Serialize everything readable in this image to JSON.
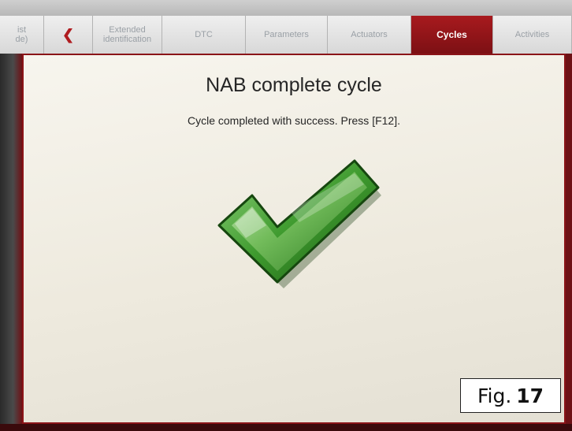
{
  "tabs": [
    {
      "label": "ist\nde)",
      "active": false
    },
    {
      "label": "",
      "active": false,
      "icon": "back-arrow-icon"
    },
    {
      "label": "Extended\nidentification",
      "active": false
    },
    {
      "label": "DTC",
      "active": false
    },
    {
      "label": "Parameters",
      "active": false
    },
    {
      "label": "Actuators",
      "active": false
    },
    {
      "label": "Cycles",
      "active": true
    },
    {
      "label": "Activities",
      "active": false
    }
  ],
  "panel": {
    "title": "NAB complete cycle",
    "message": "Cycle completed with success. Press [F12]."
  },
  "figure_label": {
    "prefix": "Fig.",
    "number": "17"
  },
  "colors": {
    "active_tab": "#a81a1e",
    "check_green": "#3e9a2e",
    "panel_bg": "#f3f0e8"
  }
}
